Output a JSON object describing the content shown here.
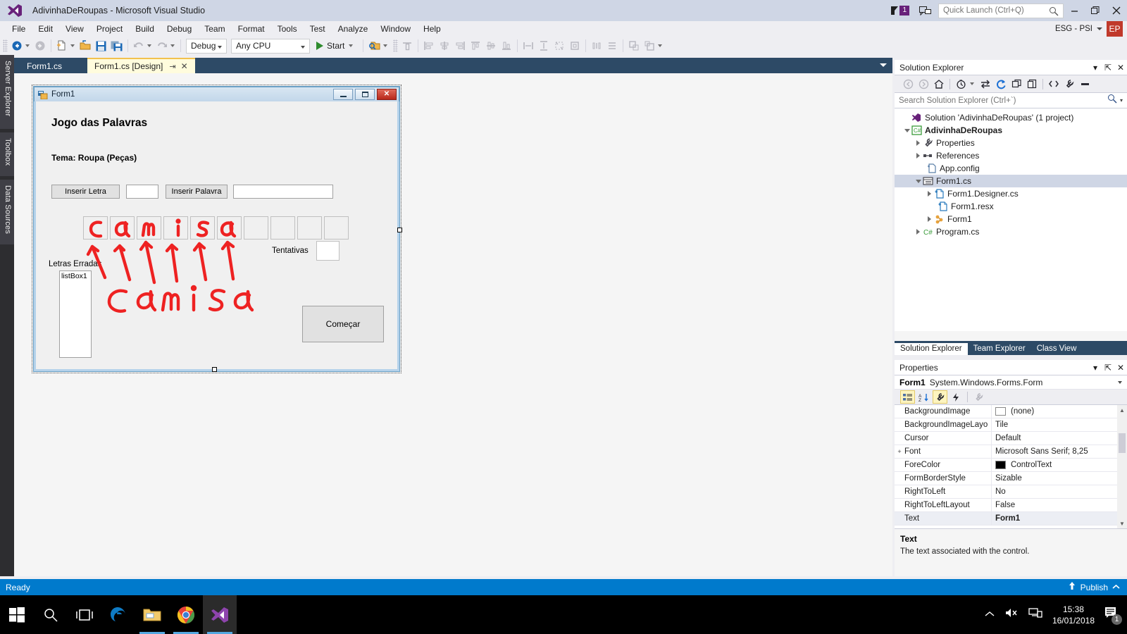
{
  "window": {
    "title": "AdivinhaDeRoupas - Microsoft Visual Studio",
    "notification_count": "1",
    "quick_launch_placeholder": "Quick Launch (Ctrl+Q)",
    "account_name": "ESG - PSI",
    "account_initials": "EP",
    "minimize_glyph": "–",
    "restore_glyph": "❐",
    "close_glyph": "✕"
  },
  "menu": {
    "items": [
      {
        "label": "File"
      },
      {
        "label": "Edit"
      },
      {
        "label": "View"
      },
      {
        "label": "Project"
      },
      {
        "label": "Build"
      },
      {
        "label": "Debug"
      },
      {
        "label": "Team"
      },
      {
        "label": "Format"
      },
      {
        "label": "Tools"
      },
      {
        "label": "Test"
      },
      {
        "label": "Analyze"
      },
      {
        "label": "Window"
      },
      {
        "label": "Help"
      }
    ]
  },
  "toolbar": {
    "configuration": "Debug",
    "platform": "Any CPU",
    "start_label": "Start",
    "icons": [
      "navigate-back-icon",
      "navigate-forward-icon",
      "new-project-icon",
      "open-file-icon",
      "save-icon",
      "save-all-icon",
      "undo-icon",
      "redo-icon",
      "find-in-files-icon",
      "align-to-grid-icon",
      "align-lefts-icon",
      "align-centers-icon",
      "align-rights-icon",
      "align-tops-icon",
      "align-middles-icon",
      "align-bottoms-icon",
      "make-same-width-icon",
      "make-same-height-icon",
      "make-same-size-icon",
      "size-to-grid-icon",
      "horizontal-spacing-icon",
      "vertical-spacing-icon",
      "bring-to-front-icon",
      "send-to-back-icon"
    ]
  },
  "left_tool_tabs": [
    {
      "label": "Server Explorer"
    },
    {
      "label": "Toolbox"
    },
    {
      "label": "Data Sources"
    }
  ],
  "document_tabs": [
    {
      "label": "Form1.cs",
      "active": false
    },
    {
      "label": "Form1.cs [Design]",
      "active": true
    }
  ],
  "designer": {
    "form": {
      "title": "Form1",
      "title_icon": "windows-form-icon"
    },
    "controls": {
      "heading": "Jogo das Palavras",
      "theme_label": "Tema: Roupa (Peças)",
      "insert_letter_button": "Inserir Letra",
      "letter_input_value": "",
      "insert_word_button": "Inserir Palavra",
      "word_input_value": "",
      "attempts_label": "Tentativas",
      "attempts_value": "",
      "wrong_letters_label": "Letras Erradas",
      "listbox_text": "listBox1",
      "start_button": "Começar",
      "letter_boxes_count": 10
    },
    "annotation": {
      "color": "#ee2222",
      "handwritten_word": "camisa",
      "letters_in_boxes": [
        "c",
        "a",
        "m",
        "i",
        "s",
        "a",
        "",
        "",
        "",
        ""
      ],
      "arrow_count": 6
    }
  },
  "solution_explorer": {
    "title": "Solution Explorer",
    "search_placeholder": "Search Solution Explorer (Ctrl+`)",
    "toolbar_icons": [
      "back-icon",
      "forward-icon",
      "home-icon",
      "pending-changes-icon",
      "sync-with-active-document-icon",
      "refresh-icon",
      "collapse-all-icon",
      "show-all-files-icon",
      "view-code-icon",
      "properties-icon",
      "preview-icon"
    ],
    "header_icons": [
      "chevron-down-icon",
      "pin-icon",
      "close-icon"
    ],
    "tree": [
      {
        "label": "Solution 'AdivinhaDeRoupas' (1 project)",
        "indent": 0,
        "arrow": "none",
        "icon": "solution-icon",
        "bold": false,
        "selected": false
      },
      {
        "label": "AdivinhaDeRoupas",
        "indent": 1,
        "arrow": "open",
        "icon": "csharp-project-icon",
        "bold": true,
        "selected": false
      },
      {
        "label": "Properties",
        "indent": 2,
        "arrow": "closed",
        "icon": "wrench-icon",
        "bold": false,
        "selected": false
      },
      {
        "label": "References",
        "indent": 2,
        "arrow": "closed",
        "icon": "references-icon",
        "bold": false,
        "selected": false
      },
      {
        "label": "App.config",
        "indent": 3,
        "arrow": "none",
        "icon": "config-file-icon",
        "bold": false,
        "selected": false
      },
      {
        "label": "Form1.cs",
        "indent": 2,
        "arrow": "open",
        "icon": "form-file-icon",
        "bold": false,
        "selected": true
      },
      {
        "label": "Form1.Designer.cs",
        "indent": 3,
        "arrow": "closed",
        "icon": "csharp-file-icon",
        "bold": false,
        "selected": false
      },
      {
        "label": "Form1.resx",
        "indent": 4,
        "arrow": "none",
        "icon": "csharp-file-icon",
        "bold": false,
        "selected": false
      },
      {
        "label": "Form1",
        "indent": 3,
        "arrow": "closed",
        "icon": "class-icon",
        "bold": false,
        "selected": false
      },
      {
        "label": "Program.cs",
        "indent": 2,
        "arrow": "closed",
        "icon": "csharp-code-icon",
        "bold": false,
        "selected": false
      }
    ]
  },
  "panel_tabs": [
    {
      "label": "Solution Explorer",
      "active": true
    },
    {
      "label": "Team Explorer",
      "active": false
    },
    {
      "label": "Class View",
      "active": false
    }
  ],
  "properties": {
    "title": "Properties",
    "object_name": "Form1",
    "object_type": "System.Windows.Forms.Form",
    "toolbar_icons": [
      "categorized-icon",
      "alphabetical-icon",
      "properties-icon",
      "events-icon",
      "property-pages-icon"
    ],
    "rows": [
      {
        "key": "BackgroundImage",
        "value": "(none)",
        "expander": "",
        "swatch": "#ffffff",
        "bold": false,
        "selected": false
      },
      {
        "key": "BackgroundImageLayo",
        "value": "Tile",
        "expander": "",
        "swatch": "",
        "bold": false,
        "selected": false
      },
      {
        "key": "Cursor",
        "value": "Default",
        "expander": "",
        "swatch": "",
        "bold": false,
        "selected": false
      },
      {
        "key": "Font",
        "value": "Microsoft Sans Serif; 8,25",
        "expander": "+",
        "swatch": "",
        "bold": false,
        "selected": false
      },
      {
        "key": "ForeColor",
        "value": "ControlText",
        "expander": "",
        "swatch": "#000000",
        "bold": false,
        "selected": false
      },
      {
        "key": "FormBorderStyle",
        "value": "Sizable",
        "expander": "",
        "swatch": "",
        "bold": false,
        "selected": false
      },
      {
        "key": "RightToLeft",
        "value": "No",
        "expander": "",
        "swatch": "",
        "bold": false,
        "selected": false
      },
      {
        "key": "RightToLeftLayout",
        "value": "False",
        "expander": "",
        "swatch": "",
        "bold": false,
        "selected": false
      },
      {
        "key": "Text",
        "value": "Form1",
        "expander": "",
        "swatch": "",
        "bold": true,
        "selected": true
      }
    ],
    "description_title": "Text",
    "description_body": "The text associated with the control."
  },
  "statusbar": {
    "status": "Ready",
    "publish_label": "Publish"
  },
  "taskbar": {
    "items": [
      {
        "name": "start-button"
      },
      {
        "name": "search-icon"
      },
      {
        "name": "task-view-icon"
      },
      {
        "name": "edge-icon"
      },
      {
        "name": "file-explorer-icon"
      },
      {
        "name": "chrome-icon"
      },
      {
        "name": "visual-studio-icon"
      }
    ],
    "clock_time": "15:38",
    "clock_date": "16/01/2018",
    "notification_count": "1"
  }
}
